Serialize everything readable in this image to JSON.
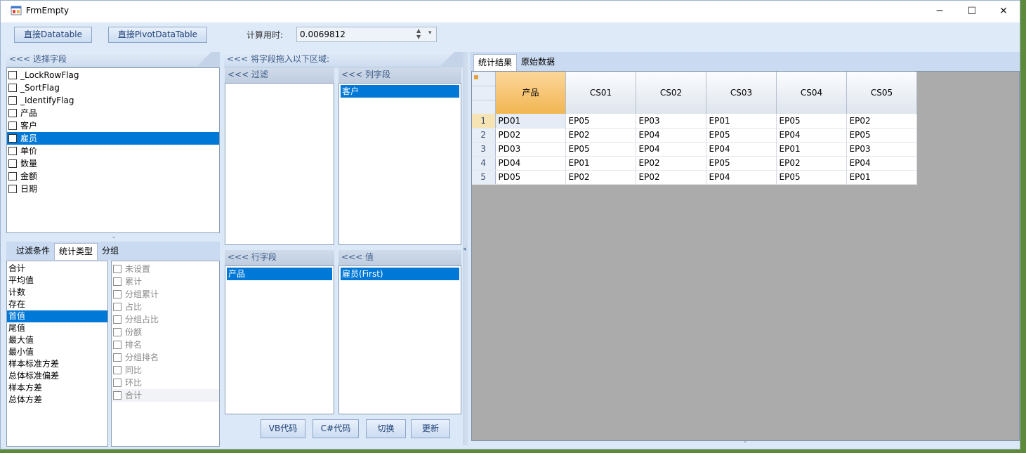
{
  "window": {
    "title": "FrmEmpty",
    "minimize": "─",
    "maximize": "☐",
    "close": "✕"
  },
  "toolbar": {
    "btn_datatable": "直接Datatable",
    "btn_pivot": "直接PivotDataTable",
    "time_label": "计算用时:",
    "time_value": "0.0069812"
  },
  "fields_panel": {
    "header": "<<< 选择字段",
    "items": [
      {
        "label": "_LockRowFlag",
        "selected": false
      },
      {
        "label": "_SortFlag",
        "selected": false
      },
      {
        "label": "_IdentifyFlag",
        "selected": false
      },
      {
        "label": "产品",
        "selected": false
      },
      {
        "label": "客户",
        "selected": false
      },
      {
        "label": "雇员",
        "selected": true
      },
      {
        "label": "单价",
        "selected": false
      },
      {
        "label": "数量",
        "selected": false
      },
      {
        "label": "金额",
        "selected": false
      },
      {
        "label": "日期",
        "selected": false
      }
    ]
  },
  "lower_tabs": {
    "tabs": [
      "过滤条件",
      "统计类型",
      "分组"
    ],
    "active": 1
  },
  "stat_types": {
    "items": [
      "合计",
      "平均值",
      "计数",
      "存在",
      "首值",
      "尾值",
      "最大值",
      "最小值",
      "样本标准方差",
      "总体标准偏差",
      "样本方差",
      "总体方差"
    ],
    "selected_index": 4
  },
  "group_options": {
    "items": [
      "未设置",
      "累计",
      "分组累计",
      "占比",
      "分组占比",
      "份额",
      "排名",
      "分组排名",
      "同比",
      "环比",
      "合计"
    ]
  },
  "drop_zone": {
    "header": "<<< 将字段拖入以下区域:",
    "filter": {
      "header": "<<< 过滤",
      "items": []
    },
    "columns": {
      "header": "<<< 列字段",
      "items": [
        "客户"
      ]
    },
    "rows": {
      "header": "<<< 行字段",
      "items": [
        "产品"
      ]
    },
    "values": {
      "header": "<<< 值",
      "items": [
        "雇员(First)"
      ]
    }
  },
  "actions": {
    "vb": "VB代码",
    "cs": "C#代码",
    "switch": "切换",
    "update": "更新"
  },
  "result_tabs": {
    "tabs": [
      "统计结果",
      "原始数据"
    ],
    "active": 0
  },
  "grid": {
    "columns": [
      "产品",
      "CS01",
      "CS02",
      "CS03",
      "CS04",
      "CS05"
    ],
    "rows": [
      {
        "n": "1",
        "cells": [
          "PD01",
          "EP05",
          "EP03",
          "EP01",
          "EP05",
          "EP02"
        ]
      },
      {
        "n": "2",
        "cells": [
          "PD02",
          "EP02",
          "EP04",
          "EP05",
          "EP04",
          "EP05"
        ]
      },
      {
        "n": "3",
        "cells": [
          "PD03",
          "EP05",
          "EP04",
          "EP04",
          "EP01",
          "EP03"
        ]
      },
      {
        "n": "4",
        "cells": [
          "PD04",
          "EP01",
          "EP02",
          "EP05",
          "EP02",
          "EP04"
        ]
      },
      {
        "n": "5",
        "cells": [
          "PD05",
          "EP02",
          "EP02",
          "EP04",
          "EP05",
          "EP01"
        ]
      }
    ]
  },
  "colors": {
    "selection": "#0078d7",
    "header_selected": "#f2b552",
    "grid_bg": "#ababab"
  }
}
